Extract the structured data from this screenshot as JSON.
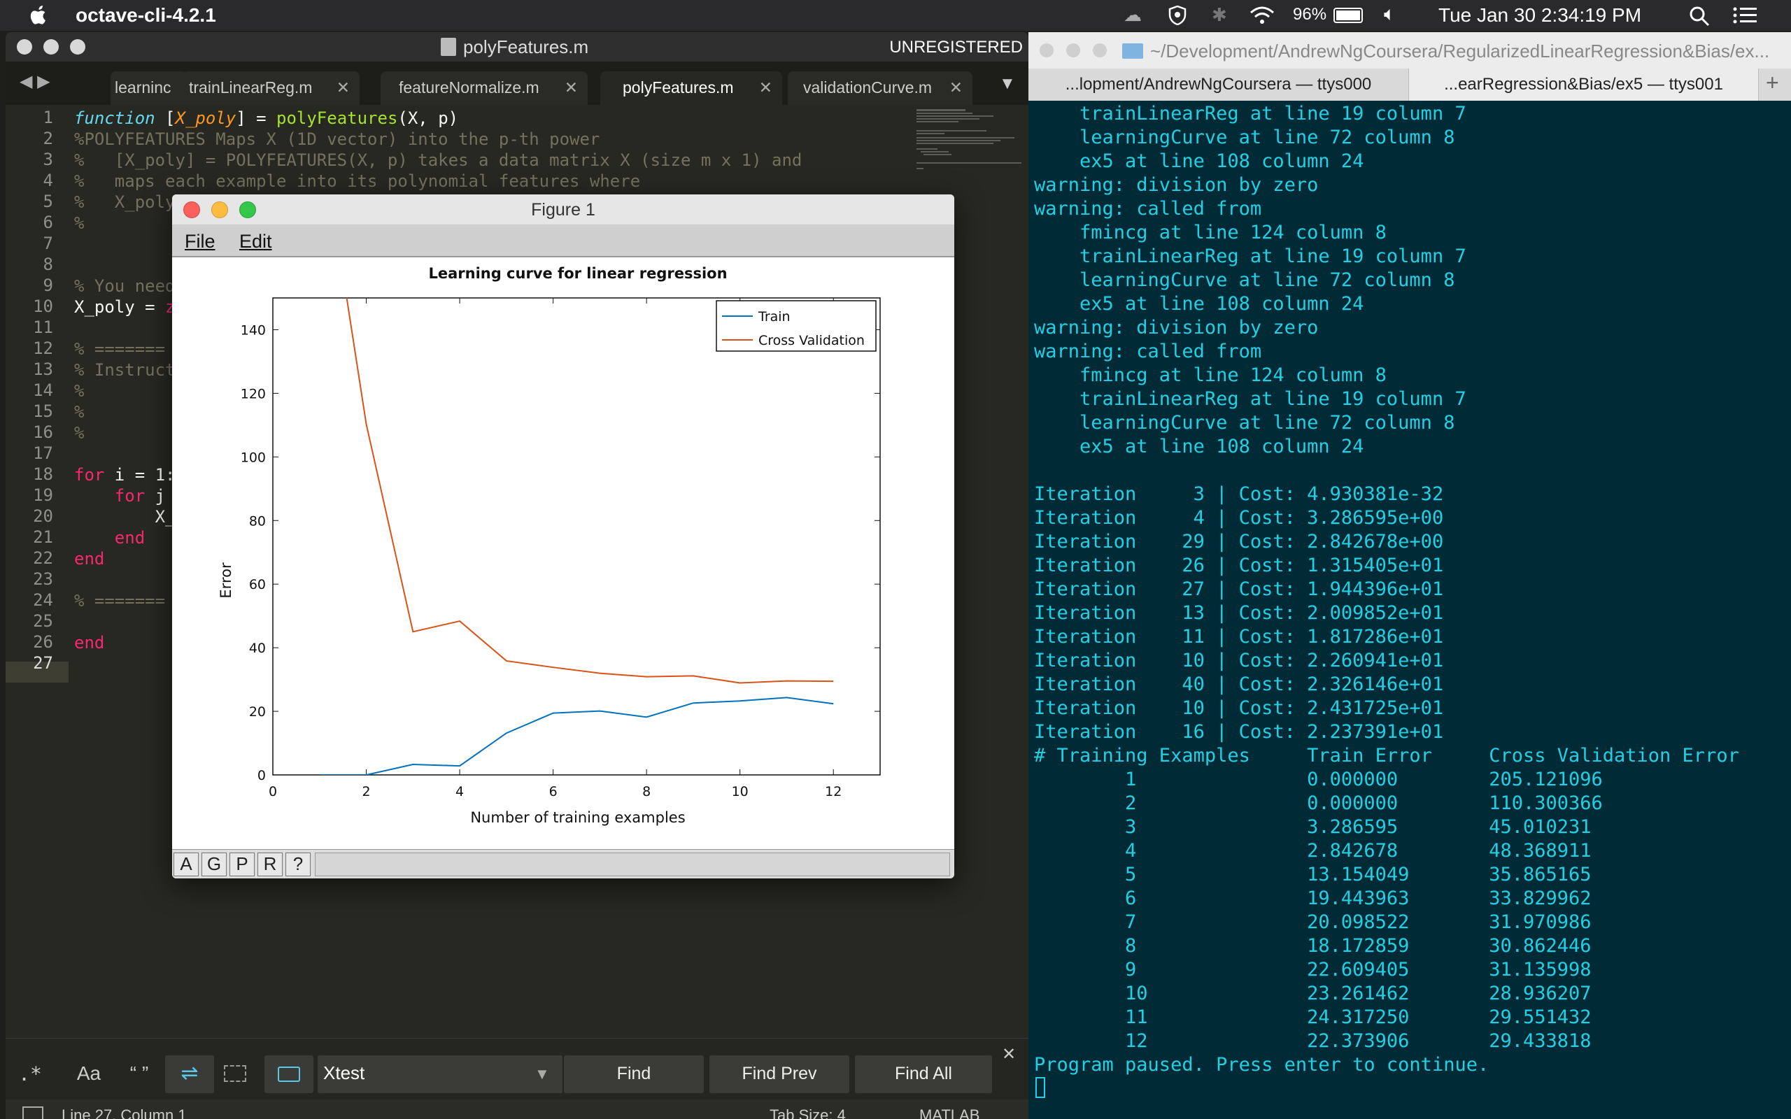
{
  "menubar": {
    "app": "octave-cli-4.2.1",
    "battery": "96%",
    "datetime": "Tue Jan 30  2:34:19 PM"
  },
  "editor": {
    "file_title": "polyFeatures.m",
    "unregistered": "UNREGISTERED",
    "tabs": [
      {
        "label": "learninc",
        "active": false
      },
      {
        "label": "trainLinearReg.m",
        "active": false
      },
      {
        "label": "featureNormalize.m",
        "active": false
      },
      {
        "label": "polyFeatures.m",
        "active": true
      },
      {
        "label": "validationCurve.m",
        "active": false
      }
    ],
    "line_numbers": [
      "1",
      "2",
      "3",
      "4",
      "5",
      "6",
      "7",
      "8",
      "9",
      "10",
      "11",
      "12",
      "13",
      "14",
      "15",
      "16",
      "17",
      "18",
      "19",
      "20",
      "21",
      "22",
      "23",
      "24",
      "25",
      "26",
      "27"
    ],
    "lines": [
      [
        {
          "t": "function ",
          "c": "#66d9ef",
          "i": true
        },
        {
          "t": "[",
          "c": "#f8f8f2"
        },
        {
          "t": "X_poly",
          "c": "#fd971f",
          "i": true
        },
        {
          "t": "] = ",
          "c": "#f8f8f2"
        },
        {
          "t": "polyFeatures",
          "c": "#a6e22e"
        },
        {
          "t": "(X, p)",
          "c": "#f8f8f2"
        }
      ],
      [
        {
          "t": "%POLYFEATURES Maps X (1D vector) into the p-th power",
          "c": "#75715e"
        }
      ],
      [
        {
          "t": "%   [X_poly] = POLYFEATURES(X, p) takes a data matrix X (size m x 1) and",
          "c": "#75715e"
        }
      ],
      [
        {
          "t": "%   maps each example into its polynomial features where",
          "c": "#75715e"
        }
      ],
      [
        {
          "t": "%   X_poly",
          "c": "#75715e"
        }
      ],
      [
        {
          "t": "%",
          "c": "#75715e"
        }
      ],
      [],
      [],
      [
        {
          "t": "% You need",
          "c": "#75715e"
        }
      ],
      [
        {
          "t": "X_poly = ",
          "c": "#f8f8f2"
        },
        {
          "t": "z",
          "c": "#f92672"
        }
      ],
      [],
      [
        {
          "t": "% =======",
          "c": "#75715e"
        }
      ],
      [
        {
          "t": "% Instruct",
          "c": "#75715e"
        }
      ],
      [
        {
          "t": "%",
          "c": "#75715e"
        }
      ],
      [
        {
          "t": "%",
          "c": "#75715e"
        }
      ],
      [
        {
          "t": "%",
          "c": "#75715e"
        }
      ],
      [],
      [
        {
          "t": "for ",
          "c": "#f92672"
        },
        {
          "t": "i = 1:",
          "c": "#f8f8f2"
        }
      ],
      [
        {
          "t": "    for ",
          "c": "#f92672"
        },
        {
          "t": "j",
          "c": "#f8f8f2"
        }
      ],
      [
        {
          "t": "        X_",
          "c": "#f8f8f2"
        }
      ],
      [
        {
          "t": "    end",
          "c": "#f92672"
        }
      ],
      [
        {
          "t": "end",
          "c": "#f92672"
        }
      ],
      [],
      [
        {
          "t": "% =======",
          "c": "#75715e"
        }
      ],
      [],
      [
        {
          "t": "end",
          "c": "#f92672"
        }
      ],
      []
    ],
    "find": {
      "value": "Xtest",
      "find": "Find",
      "find_prev": "Find Prev",
      "find_all": "Find All",
      "regex": ".*",
      "case": "Aa",
      "whole": "“ ”"
    },
    "status": {
      "position": "Line 27, Column 1",
      "tab_size": "Tab Size: 4",
      "syntax": "MATLAB"
    }
  },
  "terminal": {
    "title": "~/Development/AndrewNgCoursera/RegularizedLinearRegression&Bias/ex...",
    "tabs": [
      "...lopment/AndrewNgCoursera — ttys000",
      "...earRegression&Bias/ex5 — ttys001"
    ],
    "lines": [
      "    trainLinearReg at line 19 column 7",
      "    learningCurve at line 72 column 8",
      "    ex5 at line 108 column 24",
      "warning: division by zero",
      "warning: called from",
      "    fmincg at line 124 column 8",
      "    trainLinearReg at line 19 column 7",
      "    learningCurve at line 72 column 8",
      "    ex5 at line 108 column 24",
      "warning: division by zero",
      "warning: called from",
      "    fmincg at line 124 column 8",
      "    trainLinearReg at line 19 column 7",
      "    learningCurve at line 72 column 8",
      "    ex5 at line 108 column 24",
      "",
      "Iteration     3 | Cost: 4.930381e-32",
      "Iteration     4 | Cost: 3.286595e+00",
      "Iteration    29 | Cost: 2.842678e+00",
      "Iteration    26 | Cost: 1.315405e+01",
      "Iteration    27 | Cost: 1.944396e+01",
      "Iteration    13 | Cost: 2.009852e+01",
      "Iteration    11 | Cost: 1.817286e+01",
      "Iteration    10 | Cost: 2.260941e+01",
      "Iteration    40 | Cost: 2.326146e+01",
      "Iteration    10 | Cost: 2.431725e+01",
      "Iteration    16 | Cost: 2.237391e+01",
      "# Training Examples     Train Error     Cross Validation Error",
      "        1               0.000000        205.121096",
      "        2               0.000000        110.300366",
      "        3               3.286595        45.010231",
      "        4               2.842678        48.368911",
      "        5               13.154049       35.865165",
      "        6               19.443963       33.829962",
      "        7               20.098522       31.970986",
      "        8               18.172859       30.862446",
      "        9               22.609405       31.135998",
      "        10              23.261462       28.936207",
      "        11              24.317250       29.551432",
      "        12              22.373906       29.433818",
      "Program paused. Press enter to continue."
    ]
  },
  "figure": {
    "window_title": "Figure 1",
    "menu": [
      "File",
      "Edit"
    ],
    "toolbar": [
      "A",
      "G",
      "P",
      "R",
      "?"
    ]
  },
  "chart_data": {
    "type": "line",
    "title": "Learning curve for linear regression",
    "xlabel": "Number of training examples",
    "ylabel": "Error",
    "xlim": [
      0,
      13
    ],
    "ylim": [
      0,
      150
    ],
    "xticks": [
      0,
      2,
      4,
      6,
      8,
      10,
      12
    ],
    "yticks": [
      0,
      20,
      40,
      60,
      80,
      100,
      120,
      140
    ],
    "legend_position": "top-right",
    "x": [
      1,
      2,
      3,
      4,
      5,
      6,
      7,
      8,
      9,
      10,
      11,
      12
    ],
    "series": [
      {
        "name": "Train",
        "color": "#0072bd",
        "values": [
          0.0,
          0.0,
          3.286595,
          2.842678,
          13.154049,
          19.443963,
          20.098522,
          18.172859,
          22.609405,
          23.261462,
          24.31725,
          22.373906
        ]
      },
      {
        "name": "Cross Validation",
        "color": "#d95319",
        "values": [
          205.121096,
          110.300366,
          45.010231,
          48.368911,
          35.865165,
          33.829962,
          31.970986,
          30.862446,
          31.135998,
          28.936207,
          29.551432,
          29.433818
        ]
      }
    ]
  }
}
